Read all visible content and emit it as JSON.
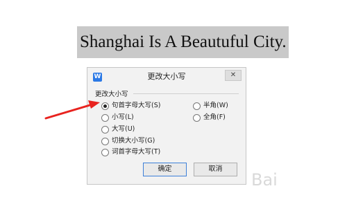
{
  "banner": {
    "text": "Shanghai Is A Beautuful City."
  },
  "dialog": {
    "title": "更改大小写",
    "group_label": "更改大小写",
    "options_left": [
      {
        "label": "句首字母大写(S)",
        "checked": true
      },
      {
        "label": "小写(L)",
        "checked": false
      },
      {
        "label": "大写(U)",
        "checked": false
      },
      {
        "label": "切换大小写(G)",
        "checked": false
      },
      {
        "label": "词首字母大写(T)",
        "checked": false
      }
    ],
    "options_right": [
      {
        "label": "半角(W)",
        "checked": false
      },
      {
        "label": "全角(F)",
        "checked": false
      }
    ],
    "ok_label": "确定",
    "cancel_label": "取消"
  },
  "watermark": {
    "text": "Bai"
  },
  "colors": {
    "arrow": "#e8231f",
    "app_icon": "#2b79e6"
  }
}
